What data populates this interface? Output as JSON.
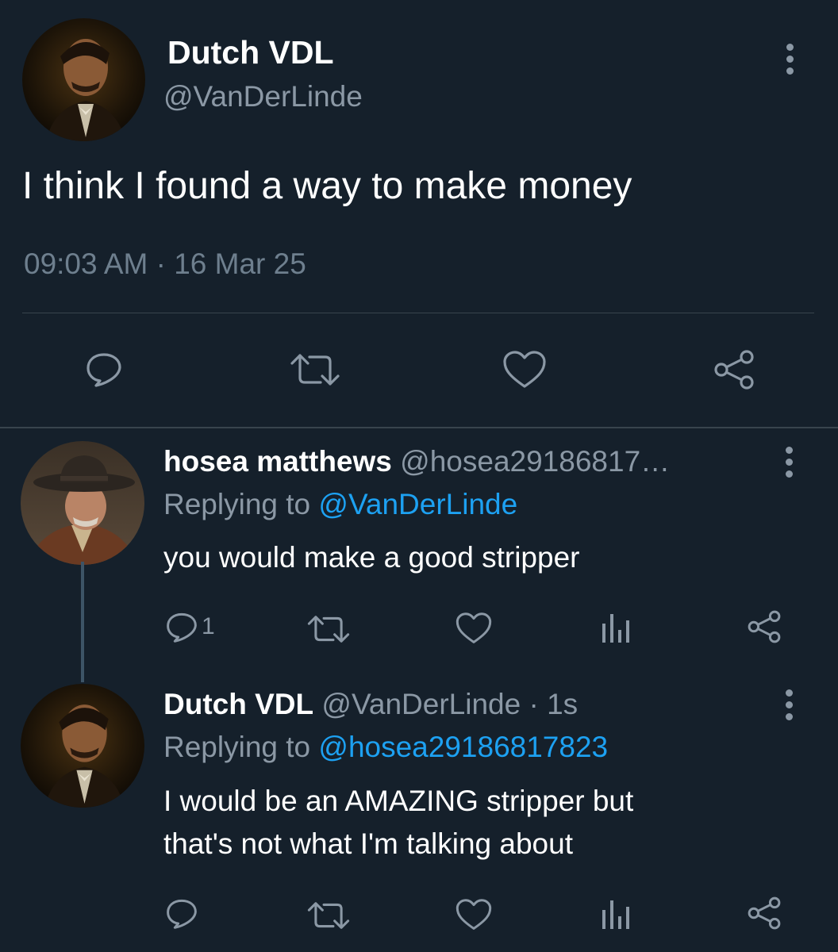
{
  "main_tweet": {
    "display_name": "Dutch VDL",
    "handle": "@VanDerLinde",
    "text": "I think I found a way to make money",
    "timestamp": "09:03 AM · 16 Mar 25",
    "avatar_icon": "dutch-portrait-avatar",
    "actions": [
      "reply-icon",
      "retweet-icon",
      "like-icon",
      "share-icon"
    ]
  },
  "replies": [
    {
      "display_name": "hosea matthews",
      "handle": "@hosea29186817…",
      "replying_prefix": "Replying to",
      "replying_to": "@VanDerLinde",
      "text": "you would make a good stripper",
      "reply_count": "1",
      "avatar_icon": "hosea-portrait-avatar"
    },
    {
      "display_name": "Dutch VDL",
      "handle": "@VanDerLinde",
      "time": "· 1s",
      "replying_prefix": "Replying to",
      "replying_to": "@hosea29186817823",
      "text_line1": "I would be an AMAZING stripper but",
      "text_line2": "that's not what I'm talking about",
      "avatar_icon": "dutch-portrait-avatar"
    }
  ],
  "colors": {
    "background": "#15202b",
    "text": "#ffffff",
    "muted": "#8b98a5",
    "link": "#1da1f2",
    "divider": "#38444d"
  }
}
